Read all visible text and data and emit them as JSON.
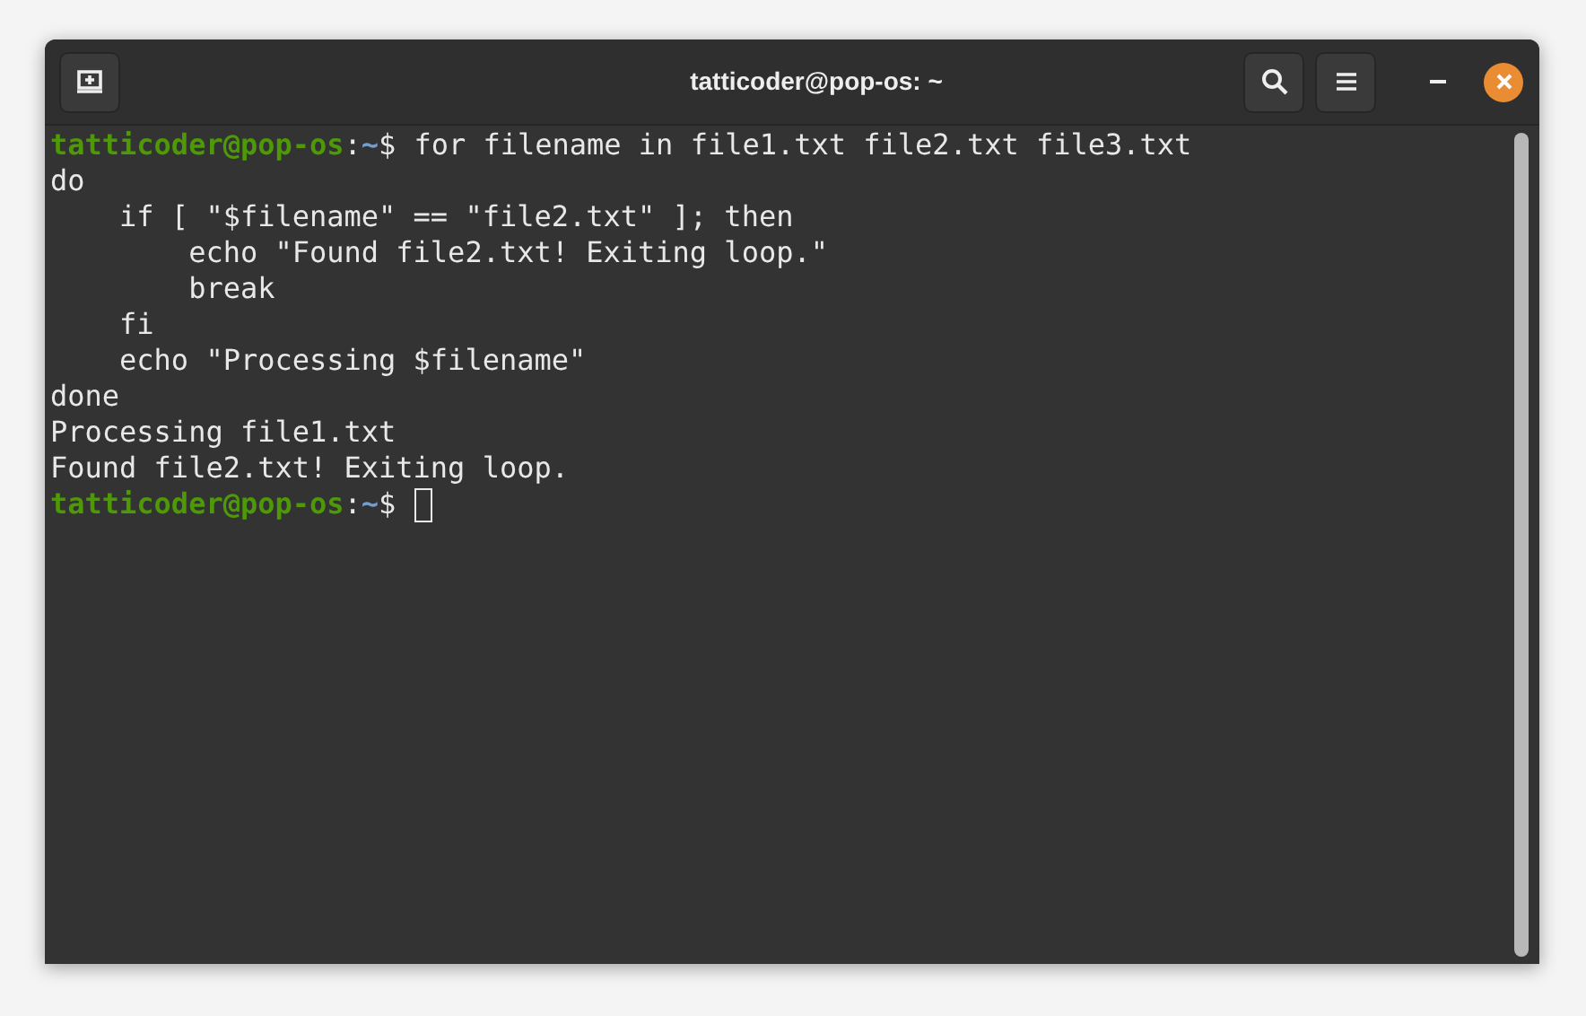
{
  "window": {
    "title": "tatticoder@pop-os: ~"
  },
  "terminal": {
    "lines": [
      {
        "kind": "prompt",
        "user_host": "tatticoder@pop-os",
        "separator": ":",
        "path": "~",
        "symbol": "$",
        "command": "for filename in file1.txt file2.txt file3.txt",
        "cursor": false
      },
      {
        "kind": "output",
        "text": "do"
      },
      {
        "kind": "output",
        "text": "    if [ \"$filename\" == \"file2.txt\" ]; then"
      },
      {
        "kind": "output",
        "text": "        echo \"Found file2.txt! Exiting loop.\""
      },
      {
        "kind": "output",
        "text": "        break"
      },
      {
        "kind": "output",
        "text": "    fi"
      },
      {
        "kind": "output",
        "text": "    echo \"Processing $filename\""
      },
      {
        "kind": "output",
        "text": "done"
      },
      {
        "kind": "output",
        "text": "Processing file1.txt"
      },
      {
        "kind": "output",
        "text": "Found file2.txt! Exiting loop."
      },
      {
        "kind": "prompt",
        "user_host": "tatticoder@pop-os",
        "separator": ":",
        "path": "~",
        "symbol": "$",
        "cursor": true
      }
    ]
  }
}
